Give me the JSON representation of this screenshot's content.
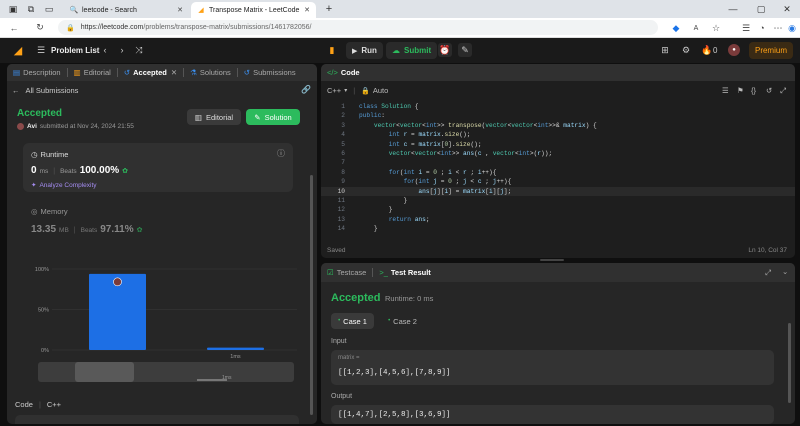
{
  "browser": {
    "tabs": [
      {
        "title": "leetcode - Search",
        "active": false
      },
      {
        "title": "Transpose Matrix - LeetCode",
        "active": true
      }
    ],
    "url_host": "https://leetcode.com",
    "url_path": "/problems/transpose-matrix/submissions/1461782056/"
  },
  "header": {
    "problem_list": "Problem List",
    "run": "Run",
    "submit": "Submit",
    "streak": "0",
    "premium": "Premium"
  },
  "left_tabs": [
    {
      "label": "Description"
    },
    {
      "label": "Editorial"
    },
    {
      "label": "Accepted"
    },
    {
      "label": "Solutions"
    },
    {
      "label": "Submissions"
    }
  ],
  "submission": {
    "back_label": "All Submissions",
    "status": "Accepted",
    "user": "Avi",
    "submitted": "submitted at Nov 24, 2024 21:55",
    "editorial_btn": "Editorial",
    "solution_btn": "Solution",
    "runtime_label": "Runtime",
    "runtime_value": "0",
    "runtime_unit": "ms",
    "beats_label": "Beats",
    "runtime_beats": "100.00%",
    "analyze": "Analyze Complexity",
    "memory_label": "Memory",
    "memory_value": "13.35",
    "memory_unit": "MB",
    "memory_beats": "97.11%",
    "code_label": "Code",
    "code_lang": "C++"
  },
  "chart_data": {
    "type": "bar",
    "ylabels": [
      "100%",
      "50%",
      "0%"
    ],
    "values": [
      94,
      3
    ],
    "xlabels": [
      "",
      "1ms"
    ],
    "mini_xlabel": "1ms"
  },
  "editor": {
    "title": "Code",
    "lang": "C++",
    "mode": "Auto",
    "status": "Saved",
    "cursor": "Ln 10, Col 37",
    "lines": [
      "class Solution {",
      "public:",
      "    vector<vector<int>> transpose(vector<vector<int>>& matrix) {",
      "        int r = matrix.size();",
      "        int c = matrix[0].size();",
      "        vector<vector<int>> ans(c , vector<int>(r));",
      "",
      "        for(int i = 0 ; i < r ; i++){",
      "            for(int j = 0 ; j < c ; j++){",
      "                ans[j][i] = matrix[i][j];",
      "            }",
      "        }",
      "        return ans;",
      "    }"
    ],
    "line_numbers": [
      "1",
      "2",
      "3",
      "4",
      "5",
      "6",
      "7",
      "8",
      "9",
      "10",
      "11",
      "12",
      "13",
      "14"
    ]
  },
  "result": {
    "testcase_tab": "Testcase",
    "result_tab": "Test Result",
    "status": "Accepted",
    "runtime": "Runtime: 0 ms",
    "case_label": "Case 1",
    "case2_label": "Case 2",
    "input_label": "Input",
    "var_label": "matrix =",
    "input_value": "[[1,2,3],[4,5,6],[7,8,9]]",
    "output_label": "Output",
    "output_value": "[[1,4,7],[2,5,8],[3,6,9]]"
  },
  "colors": {
    "accent": "#ffa116",
    "success": "#2cbb5d",
    "bar": "#1d6fe5"
  }
}
